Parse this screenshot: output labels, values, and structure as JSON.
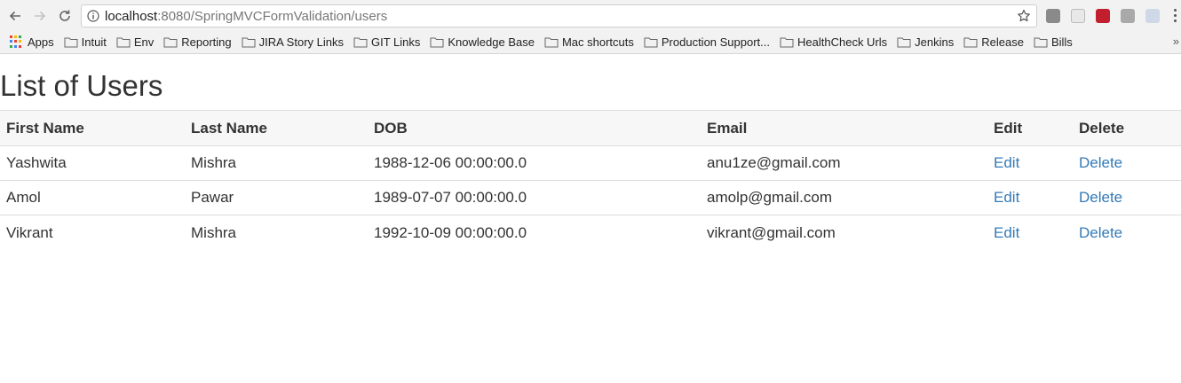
{
  "browser": {
    "url_host": "localhost",
    "url_path": ":8080/SpringMVCFormValidation/users",
    "bookmarks": [
      {
        "label": "Apps",
        "icon": "apps-grid-icon"
      },
      {
        "label": "Intuit",
        "icon": "folder-icon"
      },
      {
        "label": "Env",
        "icon": "folder-icon"
      },
      {
        "label": "Reporting",
        "icon": "folder-icon"
      },
      {
        "label": "JIRA Story Links",
        "icon": "folder-icon"
      },
      {
        "label": "GIT Links",
        "icon": "folder-icon"
      },
      {
        "label": "Knowledge Base",
        "icon": "folder-icon"
      },
      {
        "label": "Mac shortcuts",
        "icon": "folder-icon"
      },
      {
        "label": "Production Support...",
        "icon": "folder-icon"
      },
      {
        "label": "HealthCheck Urls",
        "icon": "folder-icon"
      },
      {
        "label": "Jenkins",
        "icon": "folder-icon"
      },
      {
        "label": "Release",
        "icon": "folder-icon"
      },
      {
        "label": "Bills",
        "icon": "folder-icon"
      }
    ],
    "more_bookmarks": "»"
  },
  "page": {
    "title": "List of Users",
    "columns": [
      "First Name",
      "Last Name",
      "DOB",
      "Email",
      "Edit",
      "Delete"
    ],
    "rows": [
      {
        "first_name": "Yashwita",
        "last_name": "Mishra",
        "dob": "1988-12-06 00:00:00.0",
        "email": "anu1ze@gmail.com",
        "edit": "Edit",
        "delete": "Delete"
      },
      {
        "first_name": "Amol",
        "last_name": "Pawar",
        "dob": "1989-07-07 00:00:00.0",
        "email": "amolp@gmail.com",
        "edit": "Edit",
        "delete": "Delete"
      },
      {
        "first_name": "Vikrant",
        "last_name": "Mishra",
        "dob": "1992-10-09 00:00:00.0",
        "email": "vikrant@gmail.com",
        "edit": "Edit",
        "delete": "Delete"
      }
    ]
  },
  "colors": {
    "link": "#337ab7",
    "header_bg": "#f7f7f7",
    "border": "#dddddd"
  }
}
